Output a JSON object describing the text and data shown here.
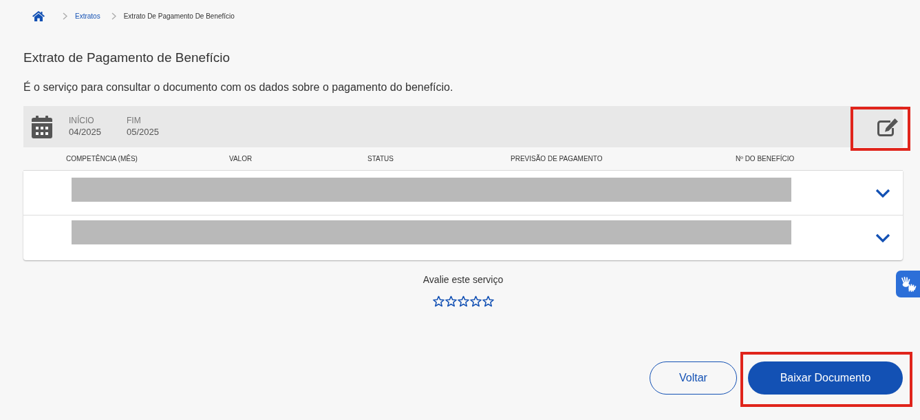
{
  "breadcrumb": {
    "items": [
      {
        "kind": "home"
      },
      {
        "kind": "link",
        "label": "Extratos"
      },
      {
        "kind": "current",
        "label": "Extrato De Pagamento De Benefício"
      }
    ]
  },
  "page": {
    "title": "Extrato de Pagamento de Benefício",
    "description": "É o serviço para consultar o documento com os dados sobre o pagamento do benefício."
  },
  "period_filter": {
    "start_label": "INÍCIO",
    "start_value": "04/2025",
    "end_label": "FIM",
    "end_value": "05/2025",
    "edit_button": {
      "highlighted": true
    }
  },
  "table": {
    "columns": [
      "COMPETÊNCIA (MÊS)",
      "VALOR",
      "STATUS",
      "PREVISÃO DE PAGAMENTO",
      "Nº DO BENEFÍCIO"
    ],
    "rows": [
      {
        "redacted": true,
        "expanded": false
      },
      {
        "redacted": true,
        "expanded": false
      }
    ]
  },
  "rating": {
    "prompt": "Avalie este serviço",
    "stars": 0
  },
  "actions": [
    {
      "kind": "secondary",
      "label": "Voltar",
      "highlighted": false
    },
    {
      "kind": "primary",
      "label": "Baixar Documento",
      "highlighted": true
    }
  ],
  "accessibility_widget": {
    "kind": "sign_language"
  }
}
